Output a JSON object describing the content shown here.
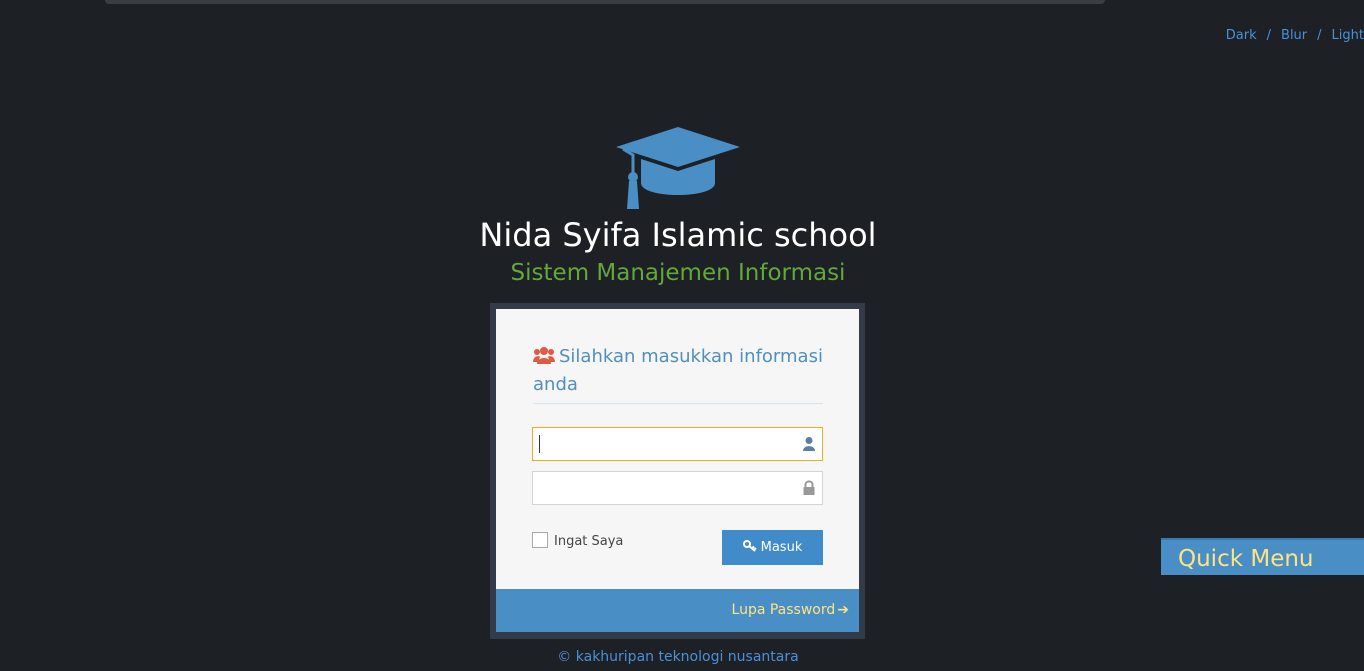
{
  "theme_switcher": {
    "dark": "Dark",
    "blur": "Blur",
    "light": "Light",
    "separator": "/"
  },
  "header": {
    "logo_icon": "graduation-cap-icon",
    "title": "Nida Syifa Islamic school",
    "subtitle": "Sistem Manajemen Informasi"
  },
  "login": {
    "heading": "Silahkan masukkan informasi anda",
    "heading_icon": "users-icon",
    "username": {
      "value": "",
      "icon": "user-icon"
    },
    "password": {
      "value": "",
      "icon": "lock-icon"
    },
    "remember_label": "Ingat Saya",
    "submit_label": "Masuk",
    "submit_icon": "key-icon",
    "forgot_label": "Lupa Password",
    "forgot_icon": "arrow-right-icon"
  },
  "footer": {
    "copyright": "© kakhuripan teknologi nusantara"
  },
  "quick_menu": {
    "label": "Quick Menu"
  },
  "colors": {
    "background": "#1d2024",
    "accent": "#428bca",
    "subtitle_green": "#62a83b",
    "link_yellow": "#fde483",
    "heading_icon": "#dd5a43"
  }
}
